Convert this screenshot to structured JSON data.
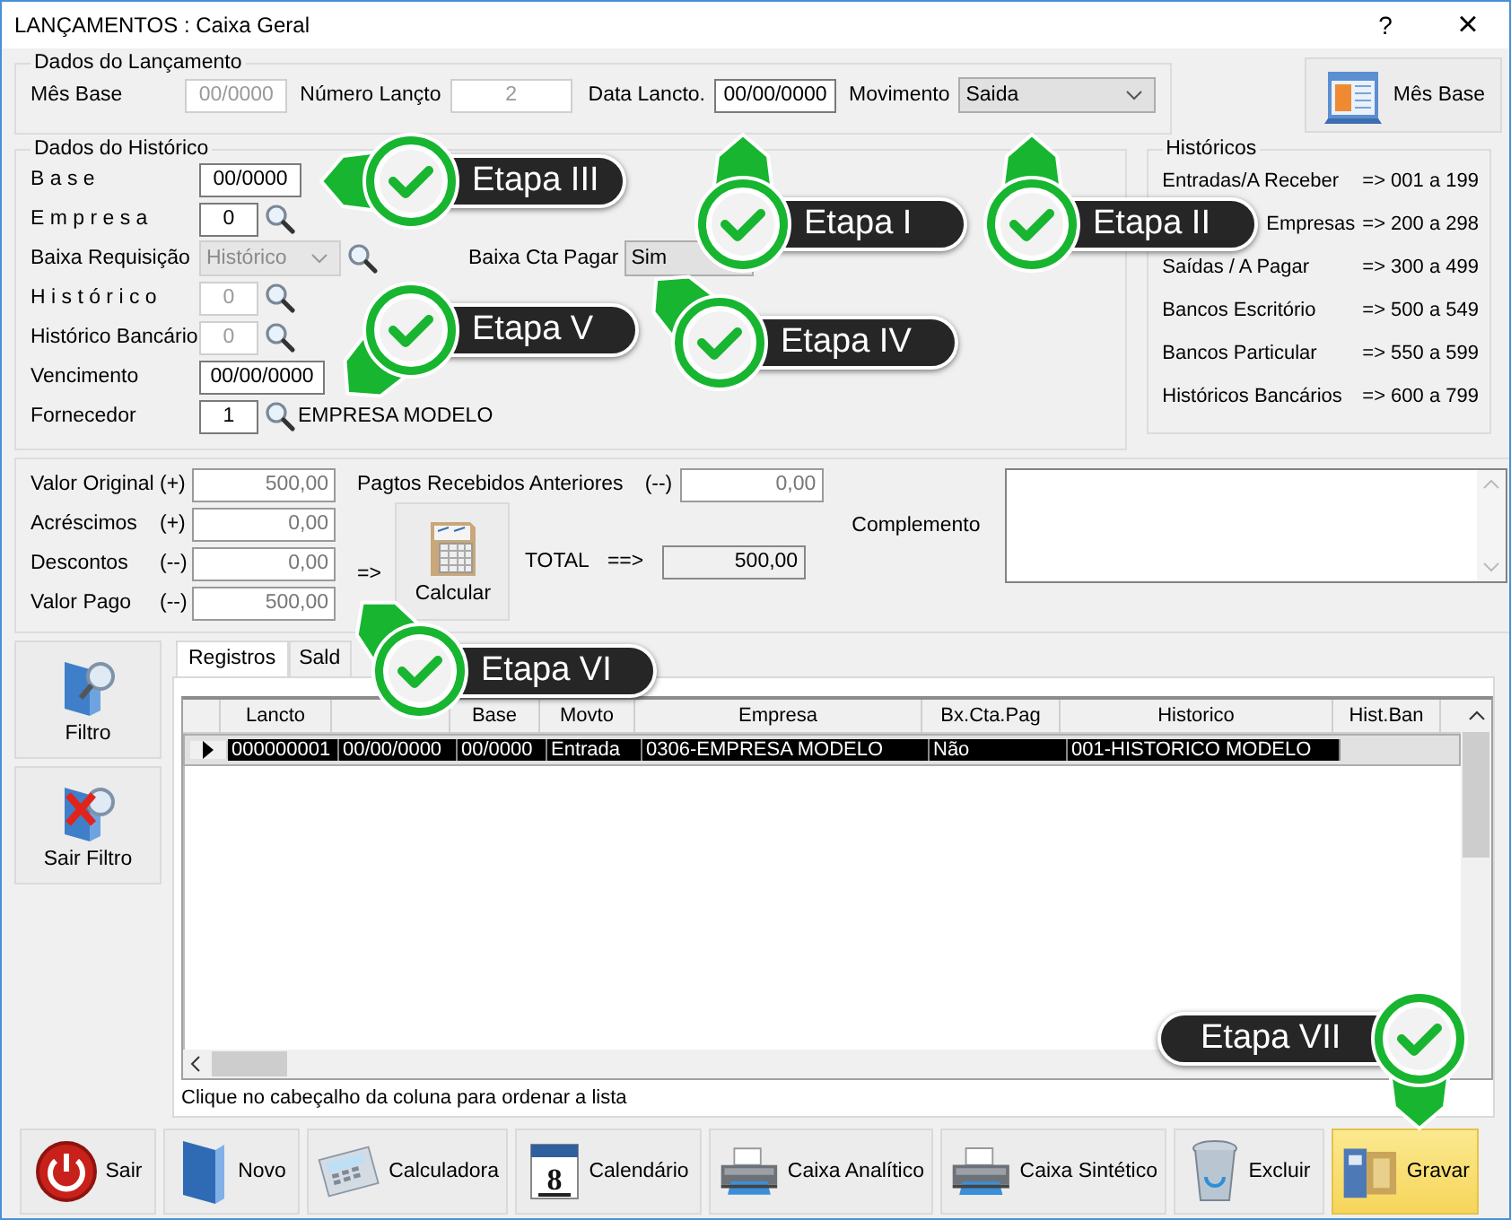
{
  "window": {
    "title": "LANÇAMENTOS : Caixa Geral",
    "help": "?",
    "close": "×"
  },
  "dados_lancamento": {
    "legend": "Dados do Lançamento",
    "fields": [
      {
        "label": "Mês Base",
        "value": "00/0000",
        "disabled": true
      },
      {
        "label": "Número Lançto",
        "value": "2",
        "disabled": true
      },
      {
        "label": "Data Lancto.",
        "value": "00/00/0000",
        "disabled": false
      }
    ],
    "movimento": {
      "label": "Movimento",
      "value": "Saida"
    }
  },
  "mes_base_button": {
    "label": "Mês Base"
  },
  "dados_historico": {
    "legend": "Dados do Histórico",
    "rows": [
      {
        "kind": "field",
        "label": "B a s e",
        "value": "00/0000",
        "disabled": false
      },
      {
        "kind": "lookup",
        "label": "E m p r e s a",
        "value": "0",
        "disabled": false
      },
      {
        "kind": "select",
        "label": "Baixa Requisição",
        "value": "Histórico",
        "disabled": true,
        "extra": {
          "label": "Baixa Cta Pagar",
          "value": "Sim"
        }
      },
      {
        "kind": "lookup",
        "label": "H i s t ó r i c o",
        "value": "0",
        "disabled": true
      },
      {
        "kind": "lookup",
        "label": "Histórico Bancário",
        "value": "0",
        "disabled": true
      },
      {
        "kind": "date",
        "label": "Vencimento",
        "value": "00/00/0000",
        "disabled": false
      },
      {
        "kind": "lookup",
        "label": "Fornecedor",
        "value": "1",
        "disabled": false,
        "name": "EMPRESA MODELO"
      }
    ]
  },
  "historicos": {
    "legend": "Históricos",
    "items": [
      {
        "label": "Entradas/A Receber",
        "range": "=> 001 a 199"
      },
      {
        "label": "Empresas",
        "range": "=> 200 a 298"
      },
      {
        "label": "Saídas / A Pagar",
        "range": "=> 300 a 499"
      },
      {
        "label": "Bancos Escritório",
        "range": "=> 500 a 549"
      },
      {
        "label": "Bancos Particular",
        "range": "=> 550 a 599"
      },
      {
        "label": "Históricos Bancários",
        "range": "=> 600 a 799"
      }
    ]
  },
  "valores": {
    "rows": [
      {
        "label": "Valor Original",
        "sign": "(+)",
        "value": "500,00"
      },
      {
        "label": "Acréscimos",
        "sign": "(+)",
        "value": "0,00"
      },
      {
        "label": "Descontos",
        "sign": "(--)",
        "value": "0,00"
      },
      {
        "label": "Valor Pago",
        "sign": "(--)",
        "value": "500,00"
      }
    ],
    "anteriores": {
      "label": "Pagtos Recebidos Anteriores",
      "sign": "(--)",
      "value": "0,00"
    },
    "arrow": "=>",
    "calcular": "Calcular",
    "total": {
      "label": "TOTAL",
      "arrow": "==>",
      "value": "500,00"
    },
    "complemento": {
      "label": "Complemento"
    }
  },
  "side_buttons": [
    {
      "label": "Filtro"
    },
    {
      "label": "Sair Filtro"
    }
  ],
  "tabs": [
    {
      "label": "Registros",
      "selected": true
    },
    {
      "label": "Sald",
      "selected": false
    }
  ],
  "table": {
    "columns": [
      "Lancto",
      "",
      "Base",
      "Movto",
      "Empresa",
      "Bx.Cta.Pag",
      "Historico",
      "Hist.Ban"
    ],
    "rows": [
      {
        "selected": true,
        "cells": [
          "000000001",
          "00/00/0000",
          "00/0000",
          "Entrada",
          "0306-EMPRESA MODELO",
          "Não",
          "001-HISTORICO MODELO",
          ""
        ]
      }
    ],
    "hint": "Clique no cabeçalho da coluna para ordenar a lista"
  },
  "toolbar": [
    {
      "label": "Sair",
      "highlighted": false
    },
    {
      "label": "Novo",
      "highlighted": false
    },
    {
      "label": "Calculadora",
      "highlighted": false
    },
    {
      "label": "Calendário",
      "icon_text": "8",
      "highlighted": false
    },
    {
      "label": "Caixa Analítico",
      "highlighted": false
    },
    {
      "label": "Caixa Sintético",
      "highlighted": false
    },
    {
      "label": "Excluir",
      "highlighted": false
    },
    {
      "label": "Gravar",
      "highlighted": true
    }
  ],
  "steps": [
    {
      "label": "Etapa III"
    },
    {
      "label": "Etapa I"
    },
    {
      "label": "Etapa II"
    },
    {
      "label": "Etapa V"
    },
    {
      "label": "Etapa IV"
    },
    {
      "label": "Etapa VI"
    },
    {
      "label": "Etapa VII"
    }
  ]
}
